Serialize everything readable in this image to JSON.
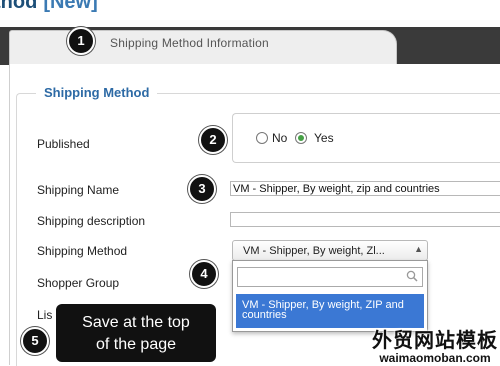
{
  "page": {
    "title_fragment": "thod",
    "title_suffix": "[New]"
  },
  "tabs": [
    {
      "label": "Shipping Method Information"
    }
  ],
  "form": {
    "legend": "Shipping Method",
    "published": {
      "label": "Published",
      "options": [
        "No",
        "Yes"
      ],
      "selected": "Yes"
    },
    "shipping_name": {
      "label": "Shipping Name",
      "value": "VM - Shipper, By weight, zip and countries"
    },
    "shipping_description": {
      "label": "Shipping description",
      "value": ""
    },
    "shipping_method": {
      "label": "Shipping Method",
      "selected_display": "VM - Shipper, By weight, Zl...",
      "dropdown": {
        "search_value": "",
        "highlighted_option": "VM - Shipper, By weight, ZIP and countries"
      }
    },
    "shopper_group": {
      "label": "Shopper Group"
    },
    "list_label_partial": "Lis"
  },
  "callouts": [
    {
      "number": "1"
    },
    {
      "number": "2"
    },
    {
      "number": "3"
    },
    {
      "number": "4"
    },
    {
      "number": "5"
    }
  ],
  "tooltip": {
    "line1": "Save at the top",
    "line2": "of the page"
  },
  "watermark": {
    "text_cn": "外贸网站模板",
    "url": "waimaomoban.com"
  },
  "colors": {
    "accent": "#2d6aa5",
    "highlight": "#3b78d4",
    "callout": "#111111",
    "tab_bar": "#3a3a3a"
  }
}
